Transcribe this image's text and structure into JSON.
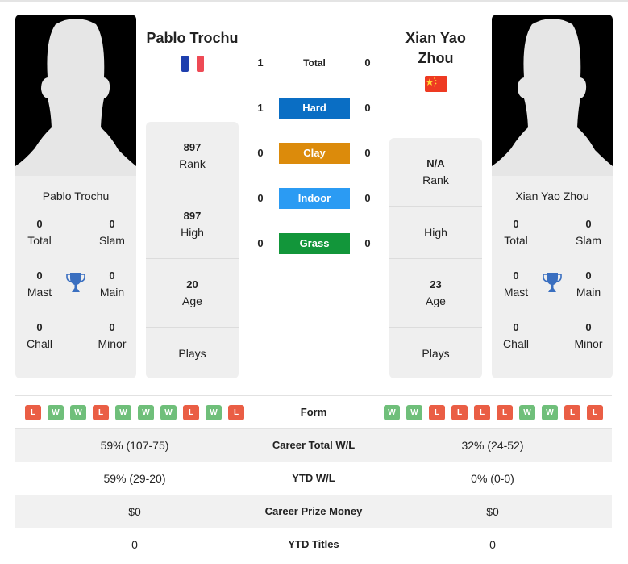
{
  "player1": {
    "name": "Pablo Trochu",
    "card_name": "Pablo Trochu",
    "flag": "france-flag",
    "titles": {
      "total": {
        "value": "0",
        "label": "Total"
      },
      "slam": {
        "value": "0",
        "label": "Slam"
      },
      "mast": {
        "value": "0",
        "label": "Mast"
      },
      "main": {
        "value": "0",
        "label": "Main"
      },
      "chall": {
        "value": "0",
        "label": "Chall"
      },
      "minor": {
        "value": "0",
        "label": "Minor"
      }
    },
    "stats": {
      "rank": {
        "value": "897",
        "label": "Rank"
      },
      "high": {
        "value": "897",
        "label": "High"
      },
      "age": {
        "value": "20",
        "label": "Age"
      },
      "plays": {
        "value": "",
        "label": "Plays"
      }
    },
    "form": [
      "L",
      "W",
      "W",
      "L",
      "W",
      "W",
      "W",
      "L",
      "W",
      "L"
    ]
  },
  "player2": {
    "name": "Xian Yao Zhou",
    "card_name": "Xian Yao Zhou",
    "flag": "china-flag",
    "titles": {
      "total": {
        "value": "0",
        "label": "Total"
      },
      "slam": {
        "value": "0",
        "label": "Slam"
      },
      "mast": {
        "value": "0",
        "label": "Mast"
      },
      "main": {
        "value": "0",
        "label": "Main"
      },
      "chall": {
        "value": "0",
        "label": "Chall"
      },
      "minor": {
        "value": "0",
        "label": "Minor"
      }
    },
    "stats": {
      "rank": {
        "value": "N/A",
        "label": "Rank"
      },
      "high": {
        "value": "",
        "label": "High"
      },
      "age": {
        "value": "23",
        "label": "Age"
      },
      "plays": {
        "value": "",
        "label": "Plays"
      }
    },
    "form": [
      "W",
      "W",
      "L",
      "L",
      "L",
      "L",
      "W",
      "W",
      "L",
      "L"
    ]
  },
  "h2h": [
    {
      "label": "Total",
      "left": "1",
      "right": "0",
      "color": ""
    },
    {
      "label": "Hard",
      "left": "1",
      "right": "0",
      "color": "#0a6ec4"
    },
    {
      "label": "Clay",
      "left": "0",
      "right": "0",
      "color": "#dc8b0b"
    },
    {
      "label": "Indoor",
      "left": "0",
      "right": "0",
      "color": "#2b9bf3"
    },
    {
      "label": "Grass",
      "left": "0",
      "right": "0",
      "color": "#12963a"
    }
  ],
  "table": {
    "form_label": "Form",
    "rows": [
      {
        "label": "Career Total W/L",
        "left": "59% (107-75)",
        "right": "32% (24-52)"
      },
      {
        "label": "YTD W/L",
        "left": "59% (29-20)",
        "right": "0% (0-0)"
      },
      {
        "label": "Career Prize Money",
        "left": "$0",
        "right": "$0"
      },
      {
        "label": "YTD Titles",
        "left": "0",
        "right": "0"
      }
    ]
  },
  "colors": {
    "win": "#6fbf7a",
    "loss": "#ea5e45",
    "trophy": "#3a6fc0"
  }
}
